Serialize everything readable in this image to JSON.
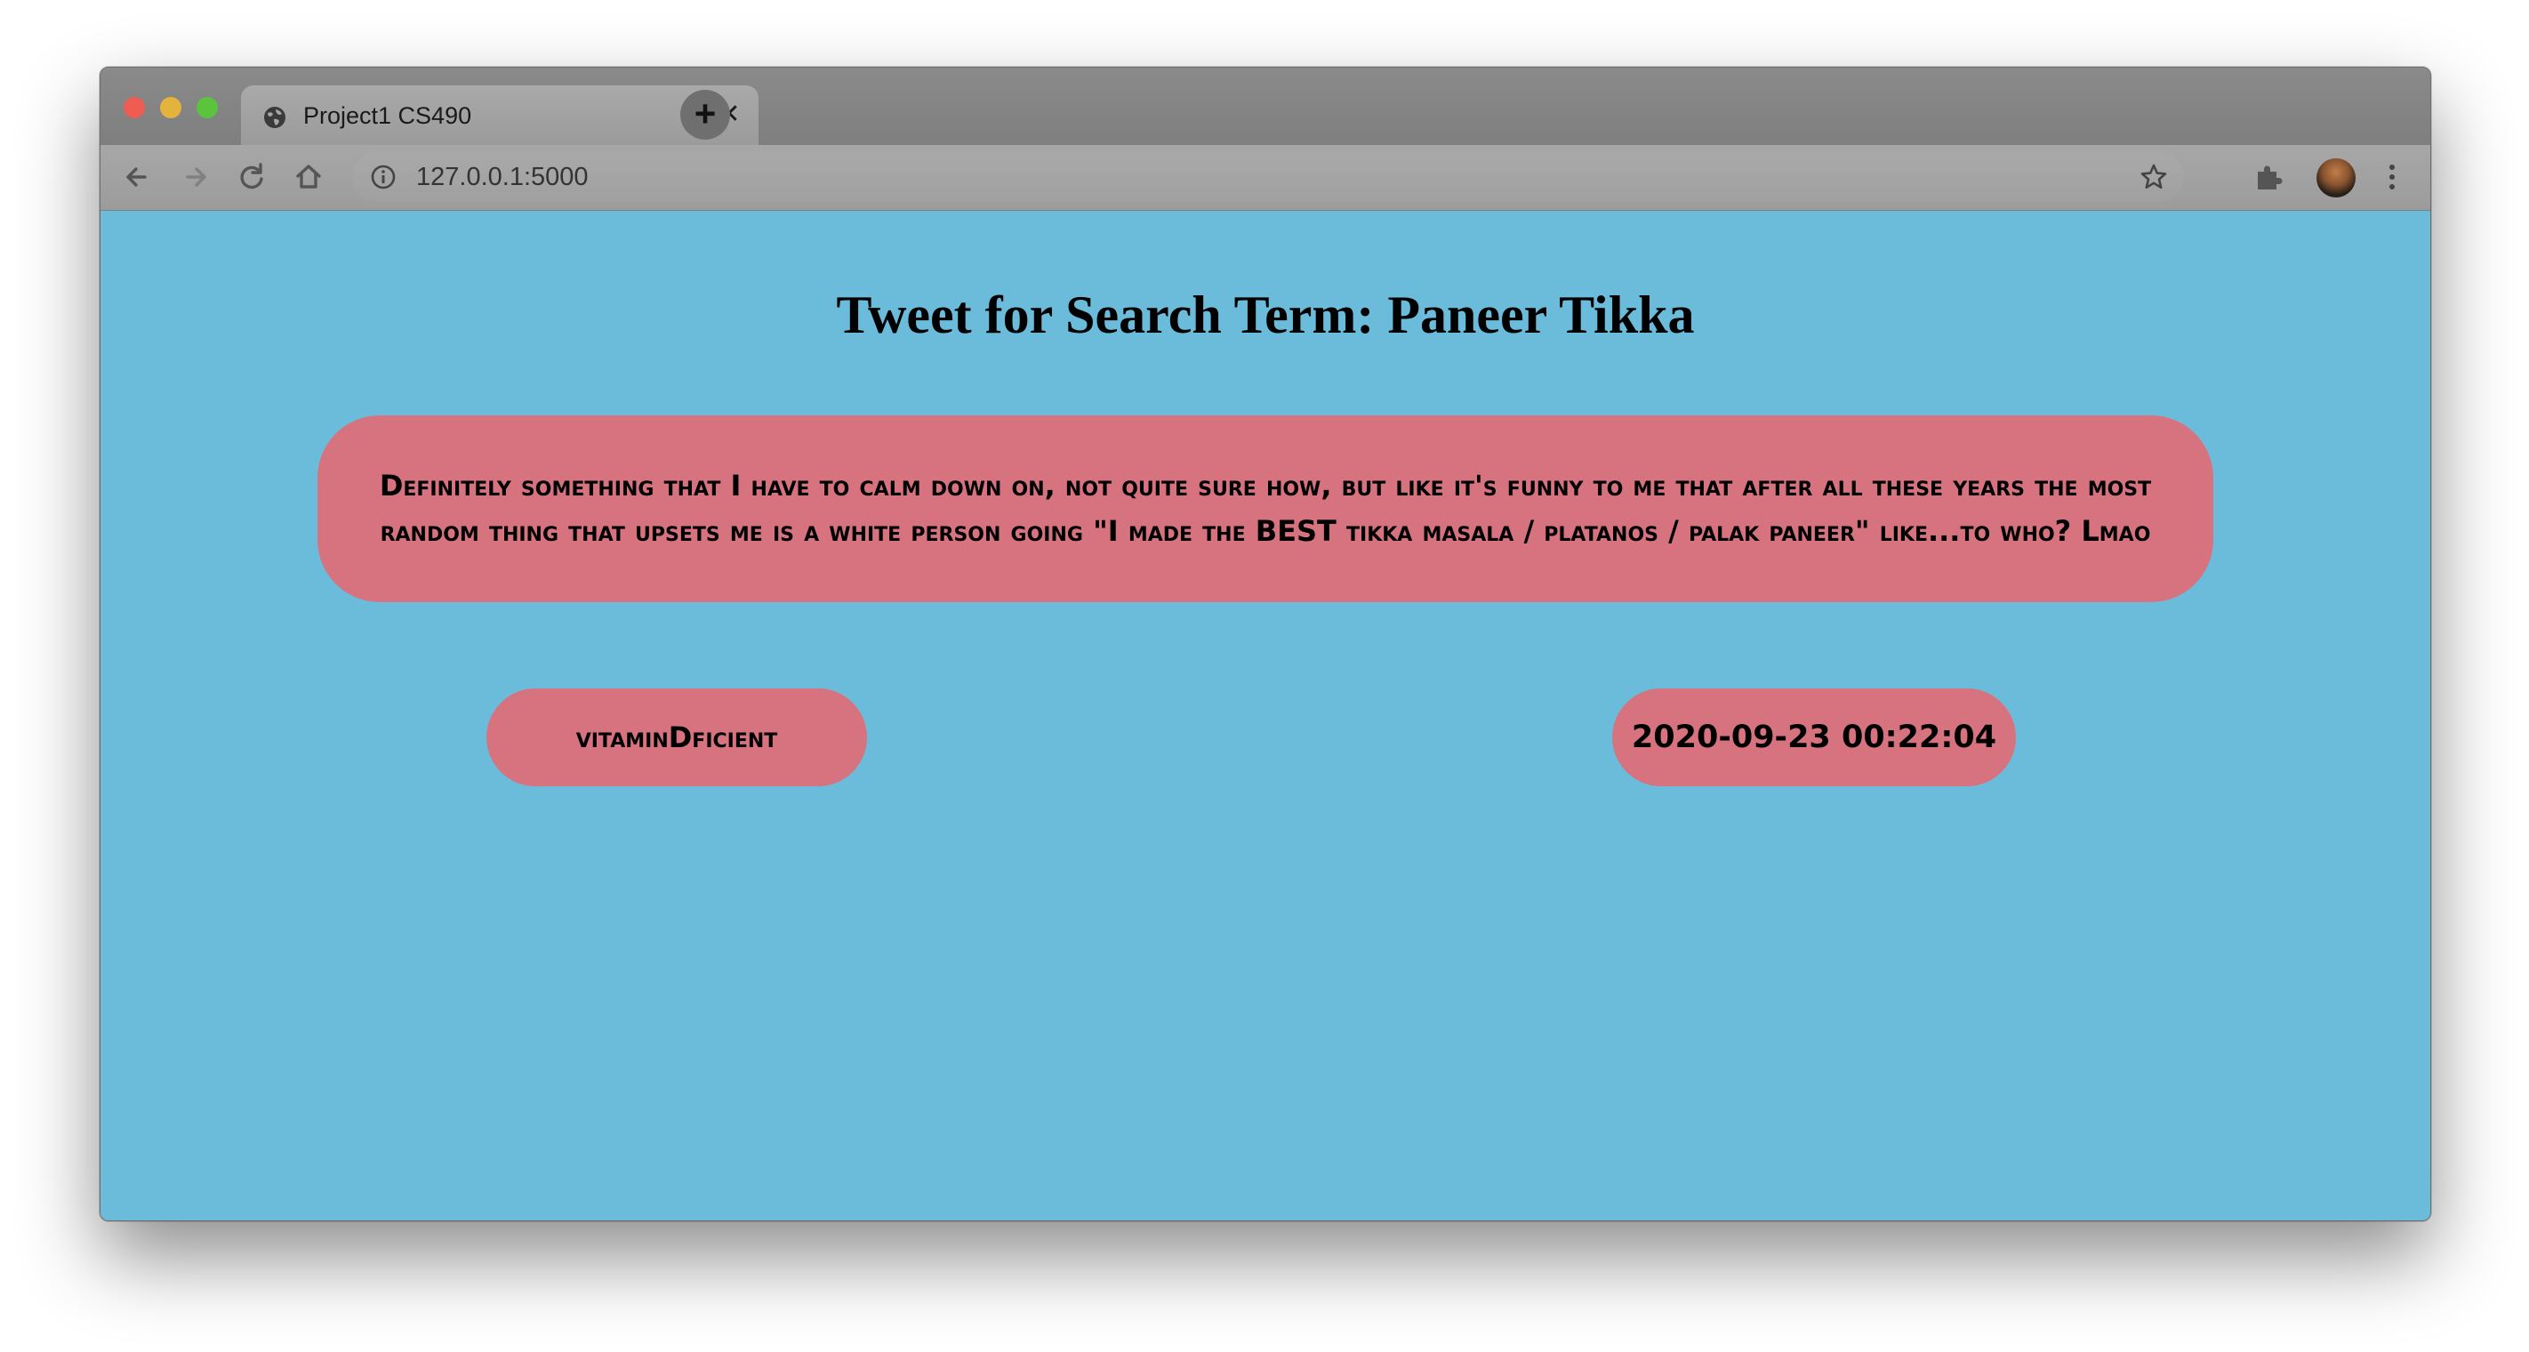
{
  "browser": {
    "tab_title": "Project1 CS490",
    "tab_close": "✕",
    "new_tab": "+",
    "url": "127.0.0.1:5000"
  },
  "icons": {
    "back": "arrow-left-icon",
    "forward": "arrow-right-icon",
    "reload": "reload-icon",
    "home": "home-icon",
    "info": "info-icon",
    "star": "star-icon",
    "extensions": "puzzle-icon",
    "menu": "kebab-menu-icon"
  },
  "colors": {
    "page_background": "#6bbcdb",
    "card_background": "#d6737e"
  },
  "page": {
    "title": "Tweet for Search Term: Paneer Tikka",
    "tweet_text": "Definitely something that I have to calm down on, not quite sure how, but like it's funny to me that after all these years the most random thing that upsets me is a white person going \"I made the BEST tikka masala / platanos / palak paneer\" like...to who? Lmao",
    "username": "vitaminDficient",
    "timestamp": "2020-09-23 00:22:04"
  }
}
